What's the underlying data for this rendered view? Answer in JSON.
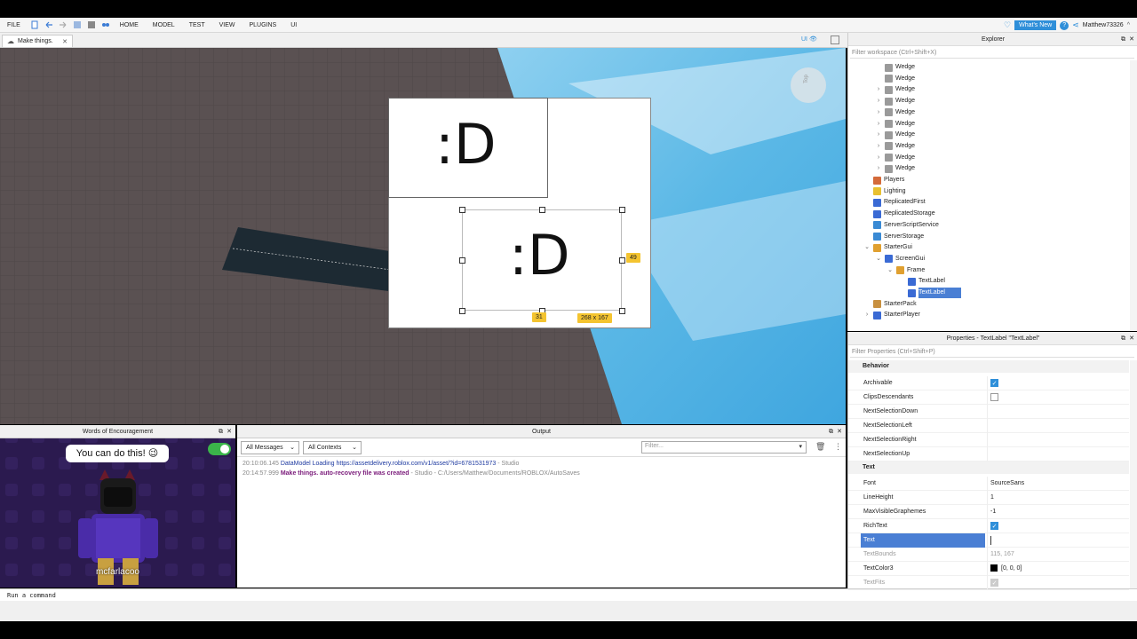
{
  "menubar": {
    "file": "FILE",
    "items": [
      "HOME",
      "MODEL",
      "TEST",
      "VIEW",
      "PLUGINS",
      "UI"
    ],
    "whats_new": "What's New",
    "username": "Matthew73326"
  },
  "tab": {
    "title": "Make things.",
    "ui_toggle": "UI"
  },
  "viewport": {
    "label1_text": ":D",
    "label2_text": ":D",
    "badge_right": "49",
    "badge_bottom": "31",
    "badge_size": "268 x 167",
    "gizmo_label": "Top"
  },
  "woe": {
    "title": "Words of Encouragement",
    "bubble": "You can do this! 😉",
    "username": "mcfarlacoo"
  },
  "output": {
    "title": "Output",
    "messages_select": "All Messages",
    "contexts_select": "All Contexts",
    "filter_placeholder": "Filter...",
    "logs": [
      {
        "time": "20:10:06.145",
        "text": "DataModel Loading https://assetdelivery.roblox.com/v1/asset/?id=6781531973",
        "suffix": " - Studio"
      },
      {
        "time": "20:14:57.999",
        "text": "Make things. auto-recovery file was created",
        "suffix": " - Studio - C:/Users/Matthew/Documents/ROBLOX/AutoSaves"
      }
    ]
  },
  "command": {
    "placeholder": "Run a command"
  },
  "explorer": {
    "title": "Explorer",
    "filter": "Filter workspace (Ctrl+Shift+X)",
    "items": [
      {
        "label": "Wedge",
        "indent": 2,
        "arrow": ""
      },
      {
        "label": "Wedge",
        "indent": 2,
        "arrow": ""
      },
      {
        "label": "Wedge",
        "indent": 2,
        "arrow": ">"
      },
      {
        "label": "Wedge",
        "indent": 2,
        "arrow": ">"
      },
      {
        "label": "Wedge",
        "indent": 2,
        "arrow": ">"
      },
      {
        "label": "Wedge",
        "indent": 2,
        "arrow": ">"
      },
      {
        "label": "Wedge",
        "indent": 2,
        "arrow": ">"
      },
      {
        "label": "Wedge",
        "indent": 2,
        "arrow": ">"
      },
      {
        "label": "Wedge",
        "indent": 2,
        "arrow": ">"
      },
      {
        "label": "Wedge",
        "indent": 2,
        "arrow": ">"
      },
      {
        "label": "Players",
        "indent": 1,
        "arrow": ""
      },
      {
        "label": "Lighting",
        "indent": 1,
        "arrow": ""
      },
      {
        "label": "ReplicatedFirst",
        "indent": 1,
        "arrow": ""
      },
      {
        "label": "ReplicatedStorage",
        "indent": 1,
        "arrow": ""
      },
      {
        "label": "ServerScriptService",
        "indent": 1,
        "arrow": ""
      },
      {
        "label": "ServerStorage",
        "indent": 1,
        "arrow": ""
      },
      {
        "label": "StarterGui",
        "indent": 1,
        "arrow": "v"
      },
      {
        "label": "ScreenGui",
        "indent": 2,
        "arrow": "v"
      },
      {
        "label": "Frame",
        "indent": 3,
        "arrow": "v"
      },
      {
        "label": "TextLabel",
        "indent": 4,
        "arrow": ""
      },
      {
        "label": "TextLabel",
        "indent": 4,
        "arrow": "",
        "selected": true
      },
      {
        "label": "StarterPack",
        "indent": 1,
        "arrow": ""
      },
      {
        "label": "StarterPlayer",
        "indent": 1,
        "arrow": ">"
      }
    ]
  },
  "properties": {
    "title": "Properties - TextLabel \"TextLabel\"",
    "filter": "Filter Properties (Ctrl+Shift+P)",
    "behavior_section": "Behavior",
    "behavior": [
      {
        "name": "Archivable",
        "value": "",
        "checkbox": "on"
      },
      {
        "name": "ClipsDescendants",
        "value": "",
        "checkbox": "off"
      },
      {
        "name": "NextSelectionDown",
        "value": ""
      },
      {
        "name": "NextSelectionLeft",
        "value": ""
      },
      {
        "name": "NextSelectionRight",
        "value": ""
      },
      {
        "name": "NextSelectionUp",
        "value": ""
      }
    ],
    "text_section": "Text",
    "text": [
      {
        "name": "Font",
        "value": "SourceSans"
      },
      {
        "name": "LineHeight",
        "value": "1"
      },
      {
        "name": "MaxVisibleGraphemes",
        "value": "-1"
      },
      {
        "name": "RichText",
        "value": "",
        "checkbox": "on"
      },
      {
        "name": "Text",
        "value": "",
        "selected": true
      },
      {
        "name": "TextBounds",
        "value": "115, 167",
        "muted": true
      },
      {
        "name": "TextColor3",
        "value": "[0, 0, 0]",
        "swatch": "#000000"
      },
      {
        "name": "TextFits",
        "value": "",
        "checkbox": "on-muted",
        "muted": true
      }
    ]
  },
  "colors": {
    "accent": "#2f8fd9",
    "selection": "#4a7fd4",
    "badge": "#f4c430",
    "toggle_on": "#3bb54a",
    "viewport_ground": "#5a5152",
    "sky": "#5bb8e6"
  }
}
